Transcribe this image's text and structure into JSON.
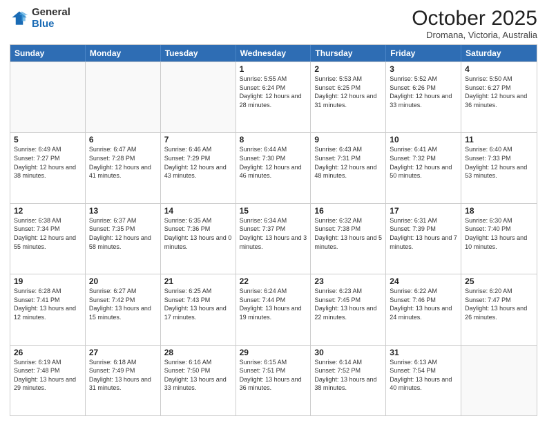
{
  "header": {
    "logo_general": "General",
    "logo_blue": "Blue",
    "month_title": "October 2025",
    "location": "Dromana, Victoria, Australia"
  },
  "days_of_week": [
    "Sunday",
    "Monday",
    "Tuesday",
    "Wednesday",
    "Thursday",
    "Friday",
    "Saturday"
  ],
  "rows": [
    [
      {
        "day": "",
        "empty": true
      },
      {
        "day": "",
        "empty": true
      },
      {
        "day": "",
        "empty": true
      },
      {
        "day": "1",
        "sunrise": "5:55 AM",
        "sunset": "6:24 PM",
        "daylight": "12 hours and 28 minutes."
      },
      {
        "day": "2",
        "sunrise": "5:53 AM",
        "sunset": "6:25 PM",
        "daylight": "12 hours and 31 minutes."
      },
      {
        "day": "3",
        "sunrise": "5:52 AM",
        "sunset": "6:26 PM",
        "daylight": "12 hours and 33 minutes."
      },
      {
        "day": "4",
        "sunrise": "5:50 AM",
        "sunset": "6:27 PM",
        "daylight": "12 hours and 36 minutes."
      }
    ],
    [
      {
        "day": "5",
        "sunrise": "6:49 AM",
        "sunset": "7:27 PM",
        "daylight": "12 hours and 38 minutes."
      },
      {
        "day": "6",
        "sunrise": "6:47 AM",
        "sunset": "7:28 PM",
        "daylight": "12 hours and 41 minutes."
      },
      {
        "day": "7",
        "sunrise": "6:46 AM",
        "sunset": "7:29 PM",
        "daylight": "12 hours and 43 minutes."
      },
      {
        "day": "8",
        "sunrise": "6:44 AM",
        "sunset": "7:30 PM",
        "daylight": "12 hours and 46 minutes."
      },
      {
        "day": "9",
        "sunrise": "6:43 AM",
        "sunset": "7:31 PM",
        "daylight": "12 hours and 48 minutes."
      },
      {
        "day": "10",
        "sunrise": "6:41 AM",
        "sunset": "7:32 PM",
        "daylight": "12 hours and 50 minutes."
      },
      {
        "day": "11",
        "sunrise": "6:40 AM",
        "sunset": "7:33 PM",
        "daylight": "12 hours and 53 minutes."
      }
    ],
    [
      {
        "day": "12",
        "sunrise": "6:38 AM",
        "sunset": "7:34 PM",
        "daylight": "12 hours and 55 minutes."
      },
      {
        "day": "13",
        "sunrise": "6:37 AM",
        "sunset": "7:35 PM",
        "daylight": "12 hours and 58 minutes."
      },
      {
        "day": "14",
        "sunrise": "6:35 AM",
        "sunset": "7:36 PM",
        "daylight": "13 hours and 0 minutes."
      },
      {
        "day": "15",
        "sunrise": "6:34 AM",
        "sunset": "7:37 PM",
        "daylight": "13 hours and 3 minutes."
      },
      {
        "day": "16",
        "sunrise": "6:32 AM",
        "sunset": "7:38 PM",
        "daylight": "13 hours and 5 minutes."
      },
      {
        "day": "17",
        "sunrise": "6:31 AM",
        "sunset": "7:39 PM",
        "daylight": "13 hours and 7 minutes."
      },
      {
        "day": "18",
        "sunrise": "6:30 AM",
        "sunset": "7:40 PM",
        "daylight": "13 hours and 10 minutes."
      }
    ],
    [
      {
        "day": "19",
        "sunrise": "6:28 AM",
        "sunset": "7:41 PM",
        "daylight": "13 hours and 12 minutes."
      },
      {
        "day": "20",
        "sunrise": "6:27 AM",
        "sunset": "7:42 PM",
        "daylight": "13 hours and 15 minutes."
      },
      {
        "day": "21",
        "sunrise": "6:25 AM",
        "sunset": "7:43 PM",
        "daylight": "13 hours and 17 minutes."
      },
      {
        "day": "22",
        "sunrise": "6:24 AM",
        "sunset": "7:44 PM",
        "daylight": "13 hours and 19 minutes."
      },
      {
        "day": "23",
        "sunrise": "6:23 AM",
        "sunset": "7:45 PM",
        "daylight": "13 hours and 22 minutes."
      },
      {
        "day": "24",
        "sunrise": "6:22 AM",
        "sunset": "7:46 PM",
        "daylight": "13 hours and 24 minutes."
      },
      {
        "day": "25",
        "sunrise": "6:20 AM",
        "sunset": "7:47 PM",
        "daylight": "13 hours and 26 minutes."
      }
    ],
    [
      {
        "day": "26",
        "sunrise": "6:19 AM",
        "sunset": "7:48 PM",
        "daylight": "13 hours and 29 minutes."
      },
      {
        "day": "27",
        "sunrise": "6:18 AM",
        "sunset": "7:49 PM",
        "daylight": "13 hours and 31 minutes."
      },
      {
        "day": "28",
        "sunrise": "6:16 AM",
        "sunset": "7:50 PM",
        "daylight": "13 hours and 33 minutes."
      },
      {
        "day": "29",
        "sunrise": "6:15 AM",
        "sunset": "7:51 PM",
        "daylight": "13 hours and 36 minutes."
      },
      {
        "day": "30",
        "sunrise": "6:14 AM",
        "sunset": "7:52 PM",
        "daylight": "13 hours and 38 minutes."
      },
      {
        "day": "31",
        "sunrise": "6:13 AM",
        "sunset": "7:54 PM",
        "daylight": "13 hours and 40 minutes."
      },
      {
        "day": "",
        "empty": true
      }
    ]
  ],
  "labels": {
    "sunrise_prefix": "Sunrise: ",
    "sunset_prefix": "Sunset: ",
    "daylight_prefix": "Daylight: "
  }
}
